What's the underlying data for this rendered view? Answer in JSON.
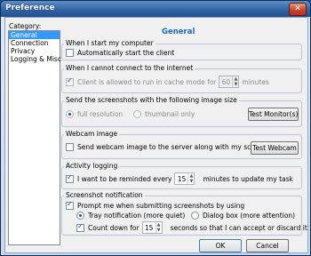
{
  "window": {
    "title": "Preference",
    "close_glyph": "✕"
  },
  "sidebar": {
    "label": "Category:",
    "items": [
      {
        "label": "General",
        "selected": true
      },
      {
        "label": "Connection"
      },
      {
        "label": "Privacy"
      },
      {
        "label": "Logging & Misc"
      }
    ]
  },
  "main": {
    "header": "General",
    "start": {
      "title": "When I start my computer",
      "auto_start": {
        "label": "Automatically start the client",
        "checked": false
      }
    },
    "offline": {
      "title": "When I cannot connect to the internet",
      "cache_mode": {
        "label": "Client is allowed to run in cache mode for",
        "checked": true,
        "value": "60",
        "unit": "minutes"
      }
    },
    "screenshot_size": {
      "title": "Send the screenshots with the following image size",
      "option_full": "full resolution",
      "option_thumb": "thumbnail only",
      "selected": "full resolution",
      "test_button": "Test Monitor(s)"
    },
    "webcam": {
      "title": "Webcam image",
      "send": {
        "label": "Send webcam image to the server along with my screenshot",
        "checked": false
      },
      "test_button": "Test Webcam"
    },
    "activity": {
      "title": "Activity logging",
      "remind": {
        "label": "I want to be reminded every",
        "checked": true,
        "value": "15",
        "suffix": "minutes to update my task"
      }
    },
    "notification": {
      "title": "Screenshot notification",
      "prompt": {
        "label": "Prompt me when submitting screenshots by using",
        "checked": true
      },
      "option_tray": "Tray notification (more quiet)",
      "option_dialog": "Dialog box (more attention)",
      "selected": "Tray notification (more quiet)",
      "countdown": {
        "label": "Count down for",
        "checked": true,
        "value": "15",
        "suffix": "seconds so that I can accept or discard it"
      }
    }
  },
  "footer": {
    "ok": "OK",
    "cancel": "Cancel"
  },
  "colors": {
    "accent": "#1e6ab3",
    "titlebar": "#2f63a3",
    "selection": "#3399ff",
    "close": "#c9452d"
  }
}
